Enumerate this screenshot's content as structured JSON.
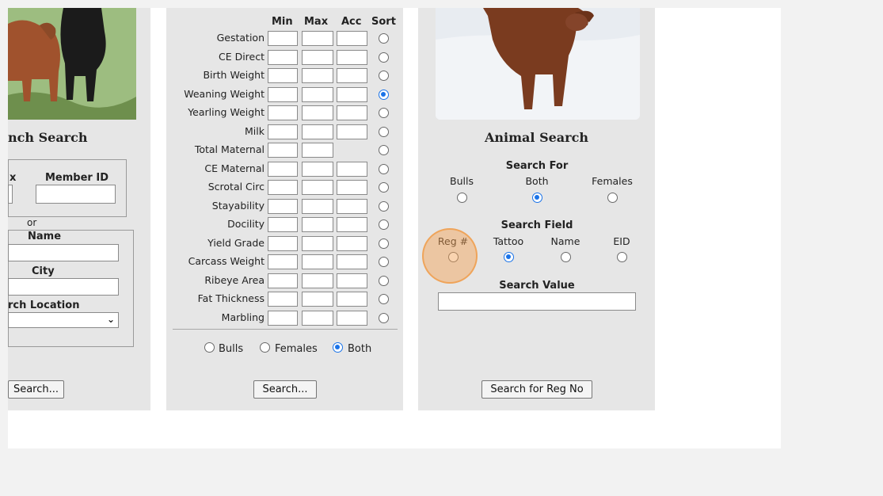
{
  "ranch": {
    "title": "nch Search",
    "x_label": "x",
    "member_label": "Member ID",
    "or": "or",
    "name_label": "Name",
    "city_label": "City",
    "location_label": "rch Location",
    "search_button": "Search..."
  },
  "epd": {
    "headers": {
      "min": "Min",
      "max": "Max",
      "acc": "Acc",
      "sort": "Sort"
    },
    "traits": [
      {
        "label": "Gestation",
        "acc": true,
        "sorted": false
      },
      {
        "label": "CE Direct",
        "acc": true,
        "sorted": false
      },
      {
        "label": "Birth Weight",
        "acc": true,
        "sorted": false
      },
      {
        "label": "Weaning Weight",
        "acc": true,
        "sorted": true
      },
      {
        "label": "Yearling Weight",
        "acc": true,
        "sorted": false
      },
      {
        "label": "Milk",
        "acc": true,
        "sorted": false
      },
      {
        "label": "Total Maternal",
        "acc": false,
        "sorted": false
      },
      {
        "label": "CE Maternal",
        "acc": true,
        "sorted": false
      },
      {
        "label": "Scrotal Circ",
        "acc": true,
        "sorted": false
      },
      {
        "label": "Stayability",
        "acc": true,
        "sorted": false
      },
      {
        "label": "Docility",
        "acc": true,
        "sorted": false
      },
      {
        "label": "Yield Grade",
        "acc": true,
        "sorted": false
      },
      {
        "label": "Carcass Weight",
        "acc": true,
        "sorted": false
      },
      {
        "label": "Ribeye Area",
        "acc": true,
        "sorted": false
      },
      {
        "label": "Fat Thickness",
        "acc": true,
        "sorted": false
      },
      {
        "label": "Marbling",
        "acc": true,
        "sorted": false
      }
    ],
    "gender": {
      "bulls": "Bulls",
      "females": "Females",
      "both": "Both",
      "selected": "both"
    },
    "search_button": "Search..."
  },
  "animal": {
    "title": "Animal Search",
    "search_for": "Search For",
    "for_options": [
      {
        "label": "Bulls",
        "selected": false
      },
      {
        "label": "Both",
        "selected": true
      },
      {
        "label": "Females",
        "selected": false
      }
    ],
    "search_field": "Search Field",
    "field_options": [
      {
        "label": "Reg #",
        "selected": false
      },
      {
        "label": "Tattoo",
        "selected": true
      },
      {
        "label": "Name",
        "selected": false
      },
      {
        "label": "EID",
        "selected": false
      }
    ],
    "search_value": "Search Value",
    "search_value_text": "",
    "search_button": "Search for Reg No"
  },
  "colors": {
    "accent": "#1a73e8",
    "highlight": "#f5a050",
    "panel": "#e6e6e6"
  }
}
